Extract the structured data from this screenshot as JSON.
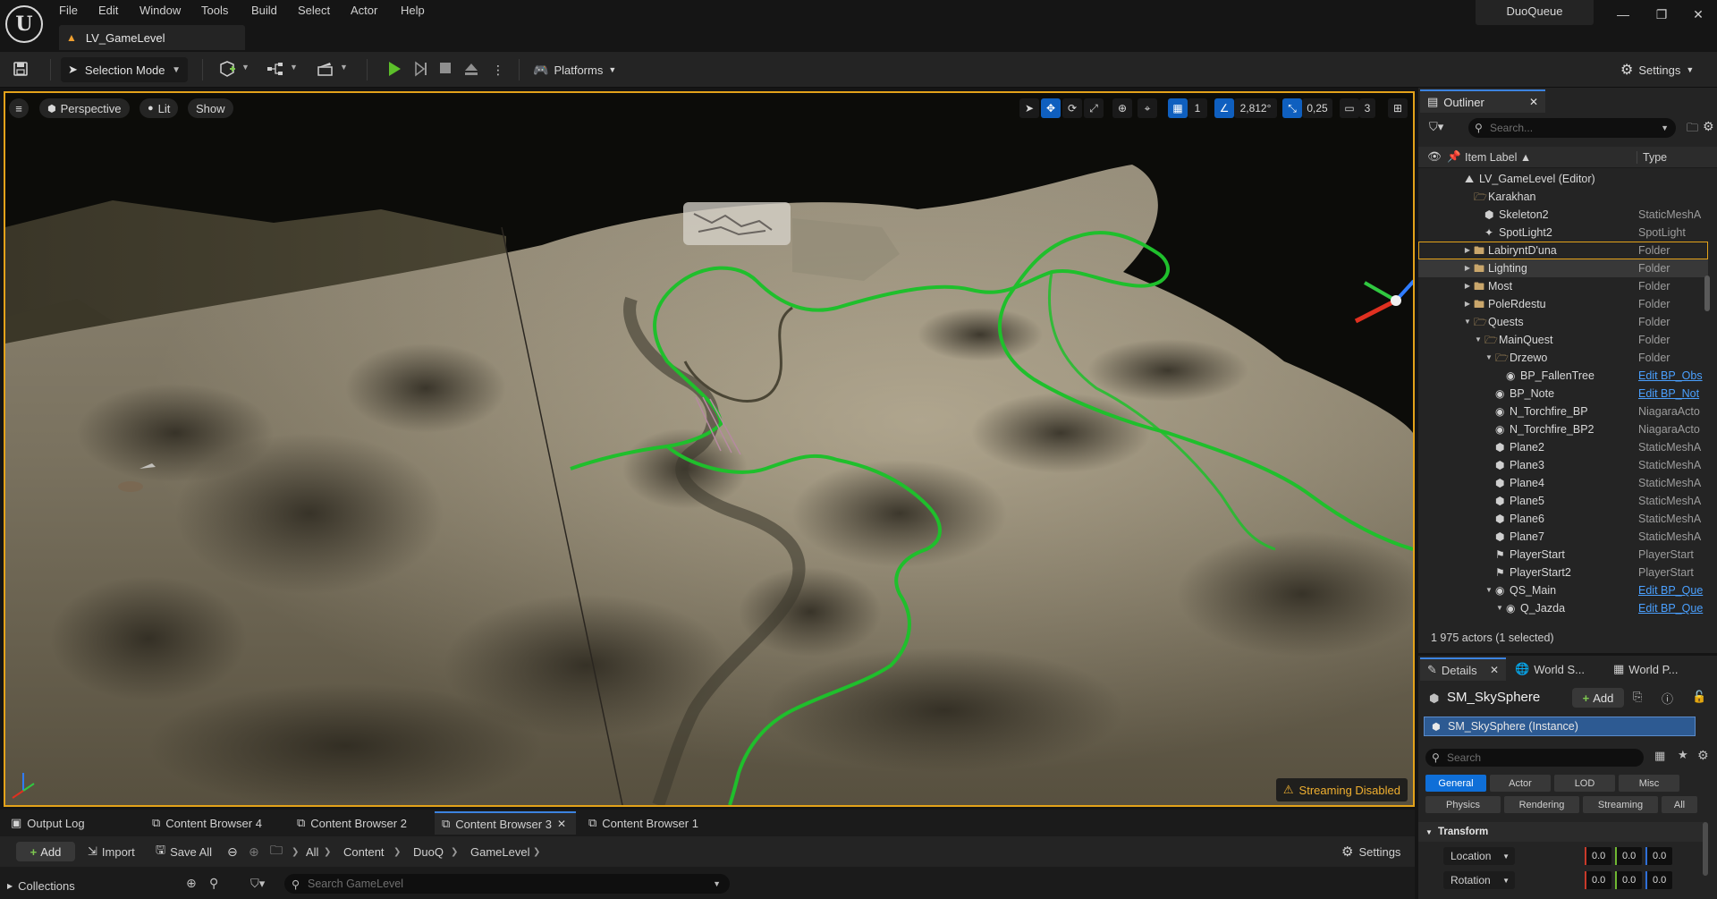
{
  "menu": [
    "File",
    "Edit",
    "Window",
    "Tools",
    "Build",
    "Select",
    "Actor",
    "Help"
  ],
  "level_tab": "LV_GameLevel",
  "project_name": "DuoQueue",
  "toolbar": {
    "selection_mode": "Selection Mode",
    "platforms": "Platforms",
    "settings": "Settings"
  },
  "viewport": {
    "perspective": "Perspective",
    "lit": "Lit",
    "show": "Show",
    "grid_size": "1",
    "rotation_snap": "2,812°",
    "scale_snap": "0,25",
    "camera_speed": "3",
    "streaming": "Streaming Disabled"
  },
  "outliner": {
    "tab": "Outliner",
    "search_placeholder": "Search...",
    "col_label": "Item Label ▲",
    "col_type": "Type",
    "rows": [
      {
        "name": "LV_GameLevel (Editor)",
        "type": ""
      },
      {
        "name": "Karakhan",
        "type": ""
      },
      {
        "name": "Skeleton2",
        "type": "StaticMeshA"
      },
      {
        "name": "SpotLight2",
        "type": "SpotLight"
      },
      {
        "name": "LabiryntD'una",
        "type": "Folder"
      },
      {
        "name": "Lighting",
        "type": "Folder"
      },
      {
        "name": "Most",
        "type": "Folder"
      },
      {
        "name": "PoleRdestu",
        "type": "Folder"
      },
      {
        "name": "Quests",
        "type": "Folder"
      },
      {
        "name": "MainQuest",
        "type": "Folder"
      },
      {
        "name": "Drzewo",
        "type": "Folder"
      },
      {
        "name": "BP_FallenTree",
        "type": "Edit BP_Obs"
      },
      {
        "name": "BP_Note",
        "type": "Edit BP_Not"
      },
      {
        "name": "N_Torchfire_BP",
        "type": "NiagaraActo"
      },
      {
        "name": "N_Torchfire_BP2",
        "type": "NiagaraActo"
      },
      {
        "name": "Plane2",
        "type": "StaticMeshA"
      },
      {
        "name": "Plane3",
        "type": "StaticMeshA"
      },
      {
        "name": "Plane4",
        "type": "StaticMeshA"
      },
      {
        "name": "Plane5",
        "type": "StaticMeshA"
      },
      {
        "name": "Plane6",
        "type": "StaticMeshA"
      },
      {
        "name": "Plane7",
        "type": "StaticMeshA"
      },
      {
        "name": "PlayerStart",
        "type": "PlayerStart"
      },
      {
        "name": "PlayerStart2",
        "type": "PlayerStart"
      },
      {
        "name": "QS_Main",
        "type": "Edit BP_Que"
      },
      {
        "name": "Q_Jazda",
        "type": "Edit BP_Que"
      }
    ],
    "actor_count": "1 975 actors (1 selected)"
  },
  "details": {
    "tabs": [
      "Details",
      "World S...",
      "World P..."
    ],
    "title": "SM_SkySphere",
    "add": "Add",
    "instance": "SM_SkySphere (Instance)",
    "search_placeholder": "Search",
    "categories_row1": [
      "General",
      "Actor",
      "LOD",
      "Misc"
    ],
    "categories_row2": [
      "Physics",
      "Rendering",
      "Streaming",
      "All"
    ],
    "section": "Transform",
    "location_label": "Location",
    "rotation_label": "Rotation",
    "location": [
      "0.0",
      "0.0",
      "0.0"
    ],
    "rotation": [
      "0.0",
      "0.0",
      "0.0"
    ]
  },
  "bottom": {
    "tabs": [
      "Output Log",
      "Content Browser 4",
      "Content Browser 2",
      "Content Browser 3",
      "Content Browser 1"
    ],
    "add": "Add",
    "import": "Import",
    "save_all": "Save All",
    "breadcrumb": [
      "All",
      "Content",
      "DuoQ",
      "GameLevel"
    ],
    "settings": "Settings",
    "collections": "Collections",
    "search_placeholder": "Search GameLevel"
  },
  "colors": {
    "accent_blue": "#0f6fd8",
    "selection_orange": "#e3a21a",
    "link_blue": "#4aa0ff",
    "path_green": "#22cc33"
  }
}
